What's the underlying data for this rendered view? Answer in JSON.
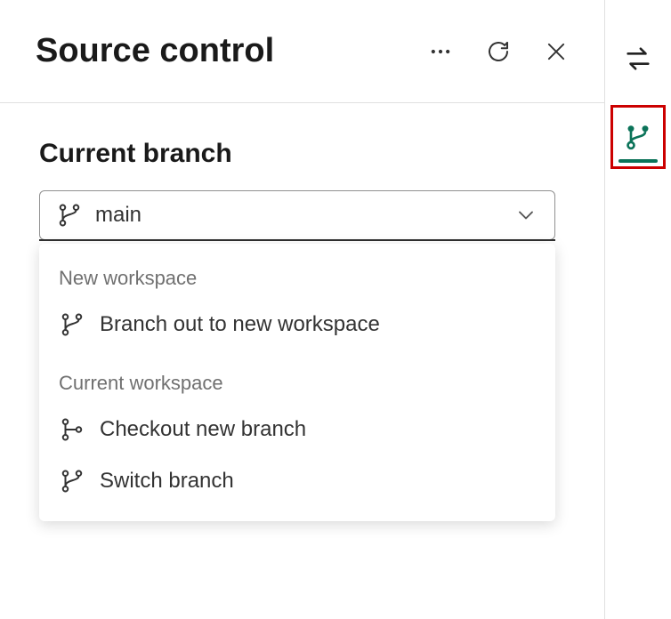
{
  "header": {
    "title": "Source control"
  },
  "sections": {
    "current_branch_label": "Current branch"
  },
  "dropdown": {
    "selected": "main",
    "groups": [
      {
        "header": "New workspace",
        "items": [
          {
            "label": "Branch out to new workspace"
          }
        ]
      },
      {
        "header": "Current workspace",
        "items": [
          {
            "label": "Checkout new branch"
          },
          {
            "label": "Switch branch"
          }
        ]
      }
    ]
  },
  "colors": {
    "accent": "#0b7359",
    "highlight_border": "#cc0000"
  }
}
